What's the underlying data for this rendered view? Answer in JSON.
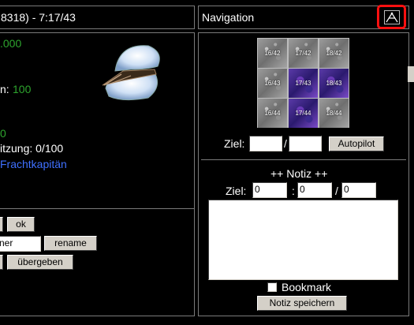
{
  "left_header": {
    "title": "8318) - 7:17/43"
  },
  "left_panel": {
    "value_green_1": ".000",
    "label_n": "n:",
    "value_green_2": "100",
    "value_green_3": "0",
    "besatzung_text": "itzung: 0/100",
    "frachtkapitaen_link": "Frachtkapitän",
    "ok_button": "ok",
    "name_input_value": "ner",
    "rename_button": "rename",
    "uebergeben_button": "übergeben"
  },
  "nav_header": {
    "title": "Navigation",
    "icon": "tools-icon"
  },
  "map": {
    "tiles": [
      {
        "label": "16/42",
        "style": "gray"
      },
      {
        "label": "17/42",
        "style": "gray"
      },
      {
        "label": "18/42",
        "style": "gray"
      },
      {
        "label": "16/43",
        "style": "gray"
      },
      {
        "label": "17/43",
        "style": "purple"
      },
      {
        "label": "18/43",
        "style": "purple"
      },
      {
        "label": "16/44",
        "style": "gray"
      },
      {
        "label": "17/44",
        "style": "purple"
      },
      {
        "label": "18/44",
        "style": "gray"
      }
    ]
  },
  "ziel_form": {
    "label": "Ziel:",
    "separator": "/",
    "x_value": "",
    "y_value": "",
    "autopilot_button": "Autopilot"
  },
  "notiz": {
    "title": "++ Notiz ++",
    "ziel_label": "Ziel:",
    "field1": "0",
    "colon": ":",
    "field2": "0",
    "slash": "/",
    "field3": "0",
    "note_text": "",
    "bookmark_label": "Bookmark",
    "bookmark_checked": false,
    "save_button": "Notiz speichern"
  }
}
